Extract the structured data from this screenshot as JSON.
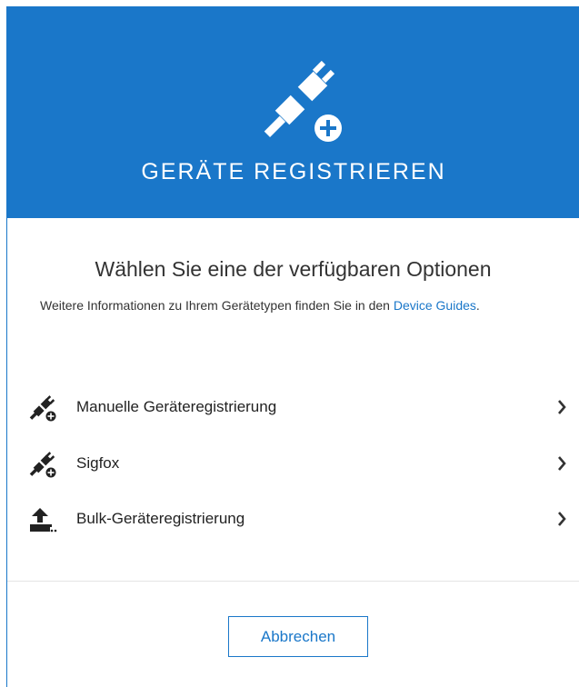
{
  "header": {
    "title": "GERÄTE REGISTRIEREN",
    "icon": "plug-plus-icon",
    "background_color": "#1a77c9"
  },
  "subtitle": "Wählen Sie eine der verfügbaren Optionen",
  "info": {
    "text": "Weitere Informationen zu Ihrem Gerätetypen finden Sie in den ",
    "link_label": "Device Guides",
    "suffix": "."
  },
  "options": [
    {
      "label": "Manuelle Geräteregistrierung",
      "icon": "plug-plus-icon"
    },
    {
      "label": "Sigfox",
      "icon": "plug-plus-icon"
    },
    {
      "label": "Bulk-Geräteregistrierung",
      "icon": "upload-icon"
    }
  ],
  "footer": {
    "cancel_label": "Abbrechen"
  },
  "colors": {
    "accent": "#1a77c9",
    "text": "#222222"
  }
}
